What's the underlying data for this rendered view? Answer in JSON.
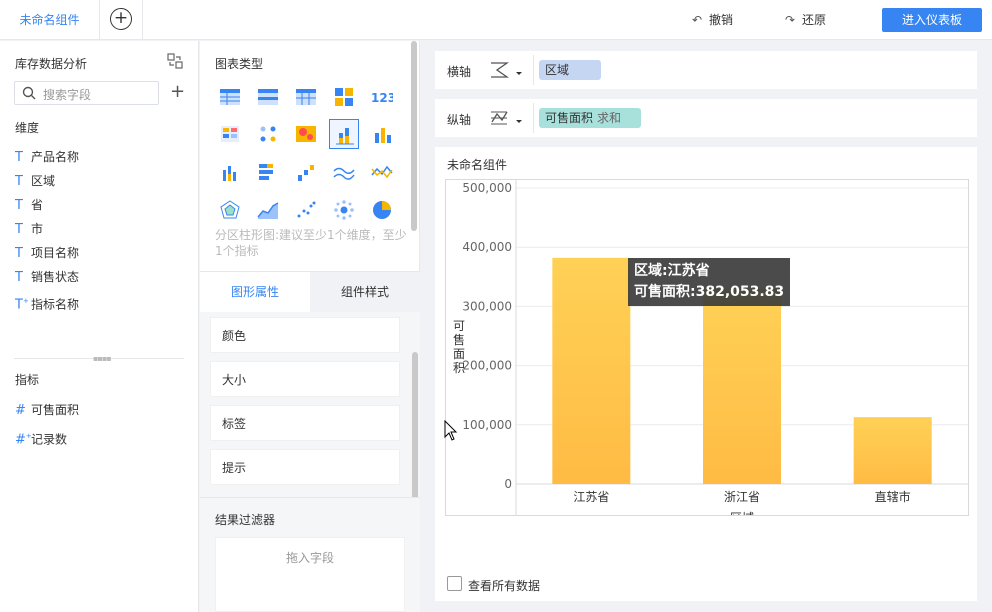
{
  "topbar": {
    "active_tab": "未命名组件",
    "add_tab": "+",
    "undo": "撤销",
    "redo": "还原",
    "enter_dashboard": "进入仪表板"
  },
  "data_panel": {
    "dataset": "库存数据分析",
    "search_placeholder": "搜索字段",
    "dimension_header": "维度",
    "dimensions": [
      "产品名称",
      "区域",
      "省",
      "市",
      "项目名称",
      "销售状态",
      "指标名称"
    ],
    "measure_header": "指标",
    "measures": [
      "可售面积",
      "记录数"
    ]
  },
  "chart_type_panel": {
    "title": "图表类型",
    "hint": "分区柱形图:建议至少1个维度，至少1个指标",
    "tabs": [
      "图形属性",
      "组件样式"
    ],
    "properties": [
      "颜色",
      "大小",
      "标签",
      "提示"
    ],
    "filter_title": "结果过滤器",
    "drop_placeholder": "拖入字段"
  },
  "axes": {
    "x_label": "横轴",
    "x_field": "区域",
    "y_label": "纵轴",
    "y_field": "可售面积",
    "y_aggregation": "求和"
  },
  "widget": {
    "title": "未命名组件",
    "view_all": "查看所有数据",
    "tooltip_line1": "区域:江苏省",
    "tooltip_line2": "可售面积:382,053.83"
  },
  "colors": {
    "accent": "#3685f2",
    "bar_top": "#ffd156",
    "bar_bottom": "#ffbb44"
  },
  "chart_data": {
    "type": "bar",
    "categories": [
      "江苏省",
      "浙江省",
      "直辖市"
    ],
    "values": [
      382053.83,
      330000,
      113000
    ],
    "xlabel": "区域",
    "ylabel": "可售面积",
    "ylim": [
      0,
      500000
    ],
    "yticks": [
      "0",
      "100,000",
      "200,000",
      "300,000",
      "400,000",
      "500,000"
    ],
    "grid": true
  }
}
